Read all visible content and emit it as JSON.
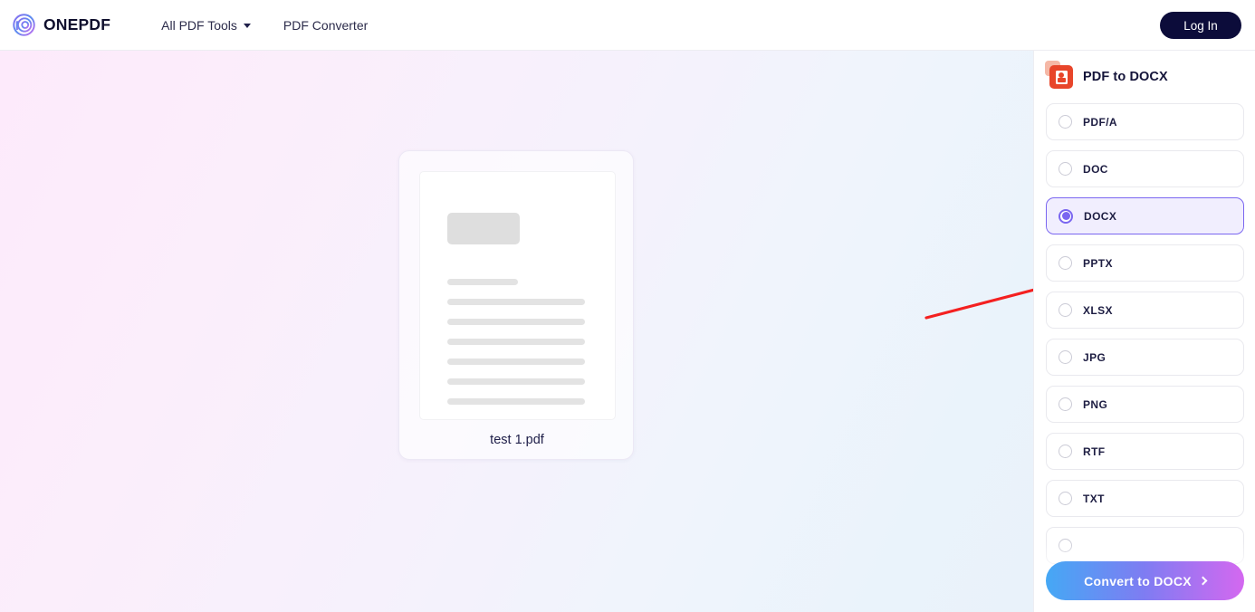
{
  "header": {
    "brand_name": "ONEPDF",
    "brand_icon": "spiral-logo-icon",
    "nav": [
      {
        "label": "All PDF Tools",
        "has_caret": true
      },
      {
        "label": "PDF Converter",
        "has_caret": false
      }
    ],
    "login_label": "Log In"
  },
  "canvas": {
    "file": {
      "name": "test 1.pdf",
      "thumbnail": "document-placeholder"
    },
    "annotation": {
      "type": "red-arrow",
      "color": "#f42020",
      "points_to": "DOCX"
    }
  },
  "panel": {
    "title": "PDF to DOCX",
    "icon": "pdf-file-icon",
    "accent_color": "#7a66f0",
    "options": [
      {
        "label": "PDF/A",
        "selected": false
      },
      {
        "label": "DOC",
        "selected": false
      },
      {
        "label": "DOCX",
        "selected": true
      },
      {
        "label": "PPTX",
        "selected": false
      },
      {
        "label": "XLSX",
        "selected": false
      },
      {
        "label": "JPG",
        "selected": false
      },
      {
        "label": "PNG",
        "selected": false
      },
      {
        "label": "RTF",
        "selected": false
      },
      {
        "label": "TXT",
        "selected": false
      },
      {
        "label": "",
        "selected": false
      }
    ],
    "convert_label": "Convert to DOCX"
  },
  "colors": {
    "brand_dark": "#10102e",
    "login_bg": "#0c0c3a",
    "selected_bg": "#f1eefe",
    "selected_border": "#7a66f0",
    "pdf_icon": "#e8452a",
    "canvas_pink": "#fdeafb",
    "canvas_blue": "#eaf3fb",
    "convert_gradient_start": "#45a8f5",
    "convert_gradient_end": "#d468f0"
  }
}
